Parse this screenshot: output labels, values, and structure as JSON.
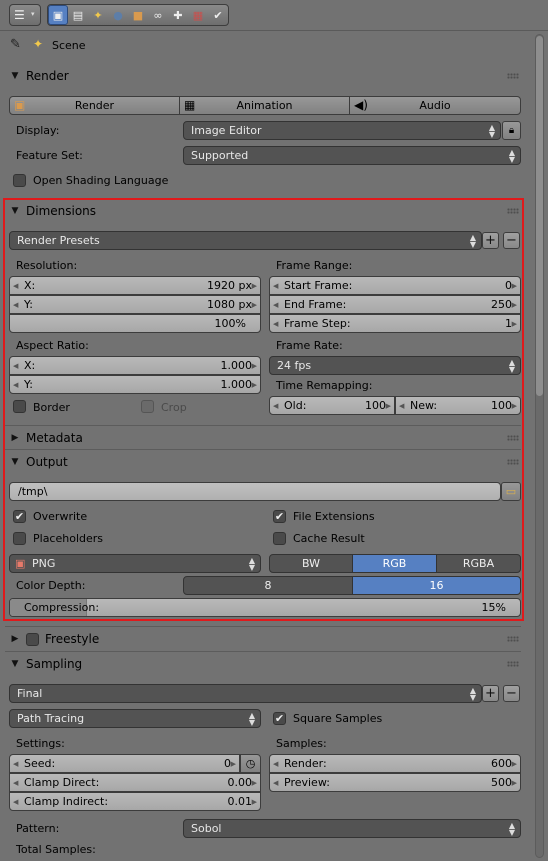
{
  "header": {
    "editor_icon": "properties-editor-icon",
    "contexts": [
      {
        "name": "render-icon",
        "glyph": "▣",
        "active": true
      },
      {
        "name": "render-layers-icon",
        "glyph": "▤"
      },
      {
        "name": "scene-icon",
        "glyph": "✦"
      },
      {
        "name": "world-icon",
        "glyph": "●"
      },
      {
        "name": "object-icon",
        "glyph": "■"
      },
      {
        "name": "constraints-icon",
        "glyph": "∞"
      },
      {
        "name": "modifiers-icon",
        "glyph": "✚"
      },
      {
        "name": "texture-icon",
        "glyph": "▦"
      },
      {
        "name": "brush-icon",
        "glyph": "✔"
      }
    ]
  },
  "scene": {
    "label": "Scene"
  },
  "render": {
    "title": "Render",
    "buttons": [
      "Render",
      "Animation",
      "Audio"
    ],
    "display_label": "Display:",
    "display_value": "Image Editor",
    "feature_set_label": "Feature Set:",
    "feature_set_value": "Supported",
    "osl_label": "Open Shading Language"
  },
  "dimensions": {
    "title": "Dimensions",
    "presets": "Render Presets",
    "resolution_label": "Resolution:",
    "res_x_label": "X:",
    "res_x": "1920 px",
    "res_y_label": "Y:",
    "res_y": "1080 px",
    "res_pct": "100%",
    "aspect_label": "Aspect Ratio:",
    "asp_x_label": "X:",
    "asp_x": "1.000",
    "asp_y_label": "Y:",
    "asp_y": "1.000",
    "border_label": "Border",
    "crop_label": "Crop",
    "frame_range_label": "Frame Range:",
    "start_label": "Start Frame:",
    "start": "0",
    "end_label": "End Frame:",
    "end": "250",
    "step_label": "Frame Step:",
    "step": "1",
    "frame_rate_label": "Frame Rate:",
    "frame_rate": "24 fps",
    "time_remap_label": "Time Remapping:",
    "old_label": "Old:",
    "old": "100",
    "new_label": "New:",
    "new": "100"
  },
  "metadata": {
    "title": "Metadata"
  },
  "output": {
    "title": "Output",
    "path": "/tmp\\",
    "overwrite_label": "Overwrite",
    "file_ext_label": "File Extensions",
    "placeholders_label": "Placeholders",
    "cache_label": "Cache Result",
    "format": "PNG",
    "color_modes": [
      "BW",
      "RGB",
      "RGBA"
    ],
    "color_mode_selected": "RGB",
    "color_depth_label": "Color Depth:",
    "depths": [
      "8",
      "16"
    ],
    "depth_selected": "16",
    "compression_label": "Compression:",
    "compression": "15%",
    "compression_fraction": 0.15
  },
  "freestyle": {
    "title": "Freestyle"
  },
  "sampling": {
    "title": "Sampling",
    "preset": "Final",
    "integrator": "Path Tracing",
    "square_label": "Square Samples",
    "settings_label": "Settings:",
    "seed_label": "Seed:",
    "seed": "0",
    "clamp_direct_label": "Clamp Direct:",
    "clamp_direct": "0.00",
    "clamp_indirect_label": "Clamp Indirect:",
    "clamp_indirect": "0.01",
    "samples_label": "Samples:",
    "render_label": "Render:",
    "render": "600",
    "preview_label": "Preview:",
    "preview": "500",
    "pattern_label": "Pattern:",
    "pattern": "Sobol",
    "total_label": "Total Samples:"
  },
  "colors": {
    "accent": "#5680c2",
    "highlight_box": "#e0191b",
    "background": "#727272"
  }
}
